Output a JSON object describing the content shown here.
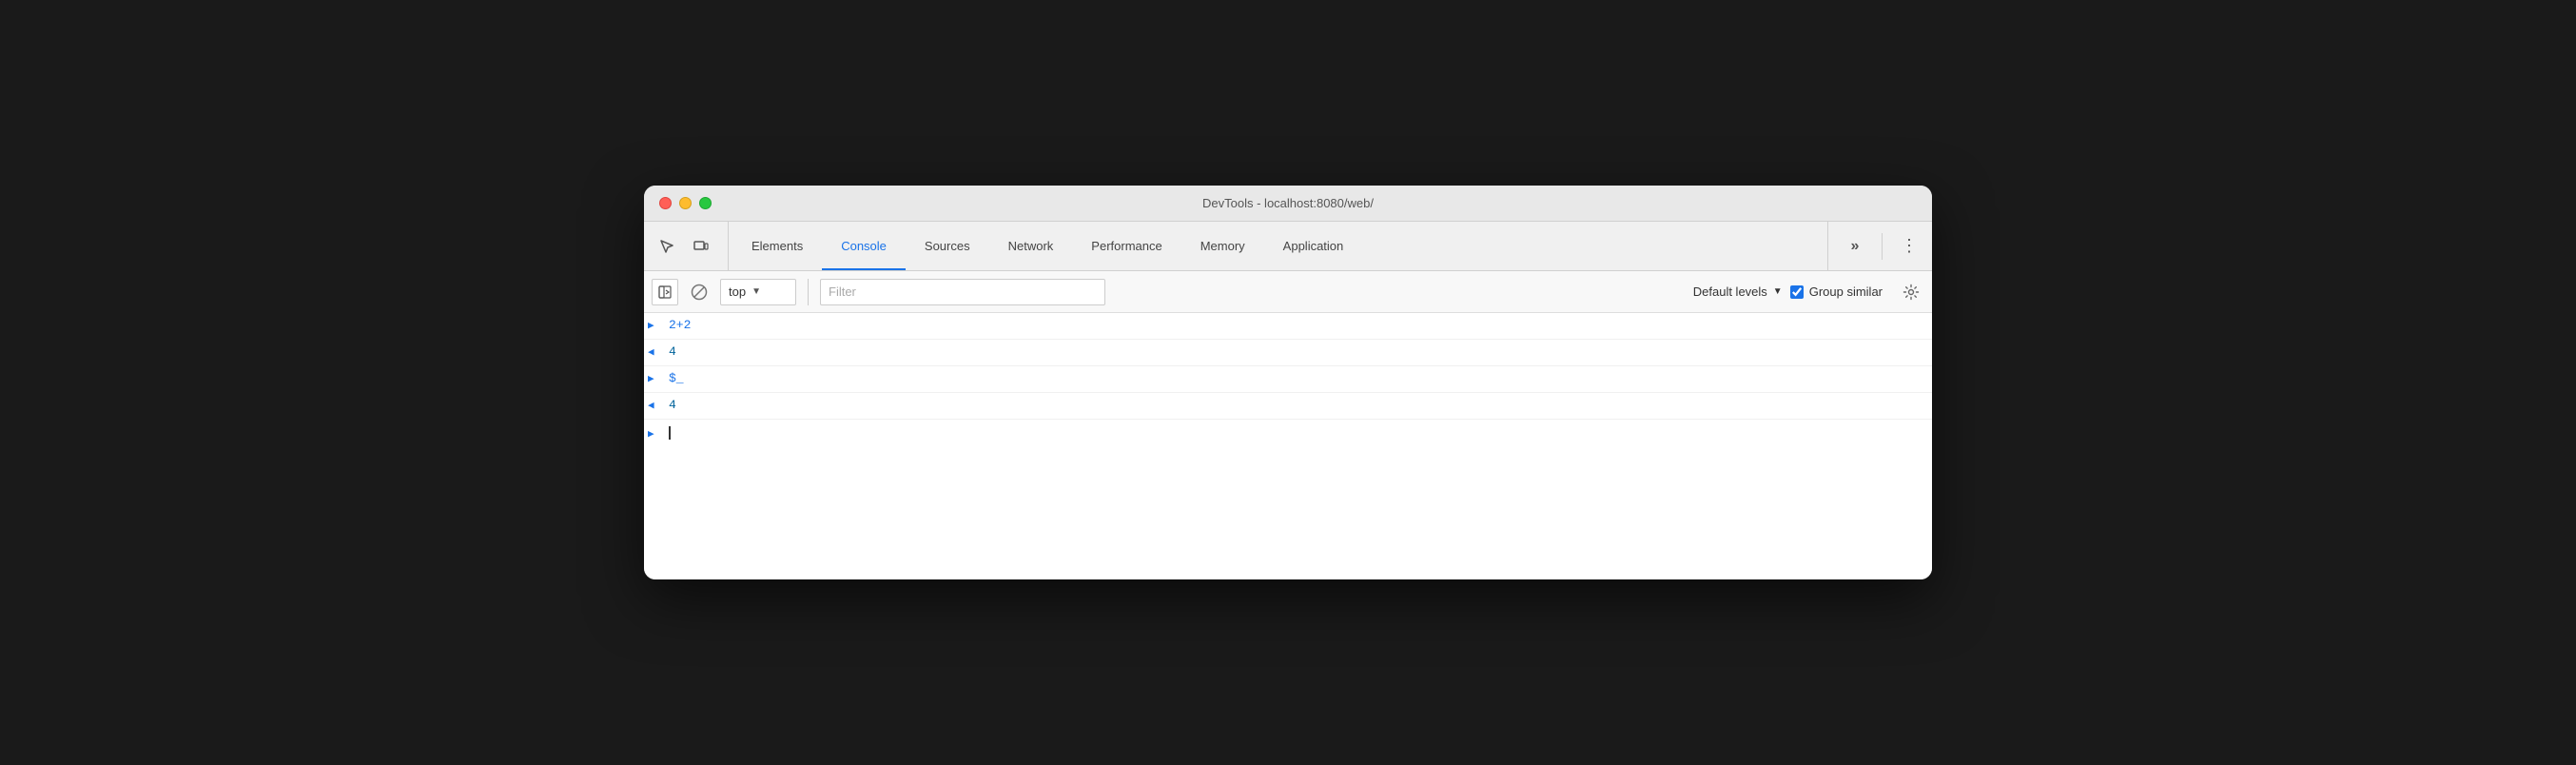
{
  "window": {
    "title": "DevTools - localhost:8080/web/"
  },
  "traffic_lights": {
    "close_label": "close",
    "minimize_label": "minimize",
    "maximize_label": "maximize"
  },
  "toolbar": {
    "inspect_icon": "⬚",
    "device_icon": "⧉",
    "tabs": [
      {
        "id": "elements",
        "label": "Elements",
        "active": false
      },
      {
        "id": "console",
        "label": "Console",
        "active": true
      },
      {
        "id": "sources",
        "label": "Sources",
        "active": false
      },
      {
        "id": "network",
        "label": "Network",
        "active": false
      },
      {
        "id": "performance",
        "label": "Performance",
        "active": false
      },
      {
        "id": "memory",
        "label": "Memory",
        "active": false
      },
      {
        "id": "application",
        "label": "Application",
        "active": false
      }
    ],
    "more_label": "»",
    "menu_label": "⋮"
  },
  "console_toolbar": {
    "sidebar_icon": "▶|",
    "clear_label": "🚫",
    "context_value": "top",
    "context_arrow": "▼",
    "filter_placeholder": "Filter",
    "levels_label": "Default levels",
    "levels_arrow": "▼",
    "group_similar_label": "Group similar",
    "settings_icon": "⚙"
  },
  "console_entries": [
    {
      "id": "entry1",
      "type": "input",
      "arrow": ">",
      "content": "2+2"
    },
    {
      "id": "entry2",
      "type": "output",
      "arrow": "<",
      "content": "4"
    },
    {
      "id": "entry3",
      "type": "input",
      "arrow": ">",
      "content": "$_"
    },
    {
      "id": "entry4",
      "type": "output",
      "arrow": "<",
      "content": "4"
    }
  ],
  "colors": {
    "active_tab": "#1a73e8",
    "input_arrow": "#1a73e8",
    "output_arrow": "#1a73e8",
    "input_text": "#1a73e8",
    "output_text": "#00639b"
  }
}
